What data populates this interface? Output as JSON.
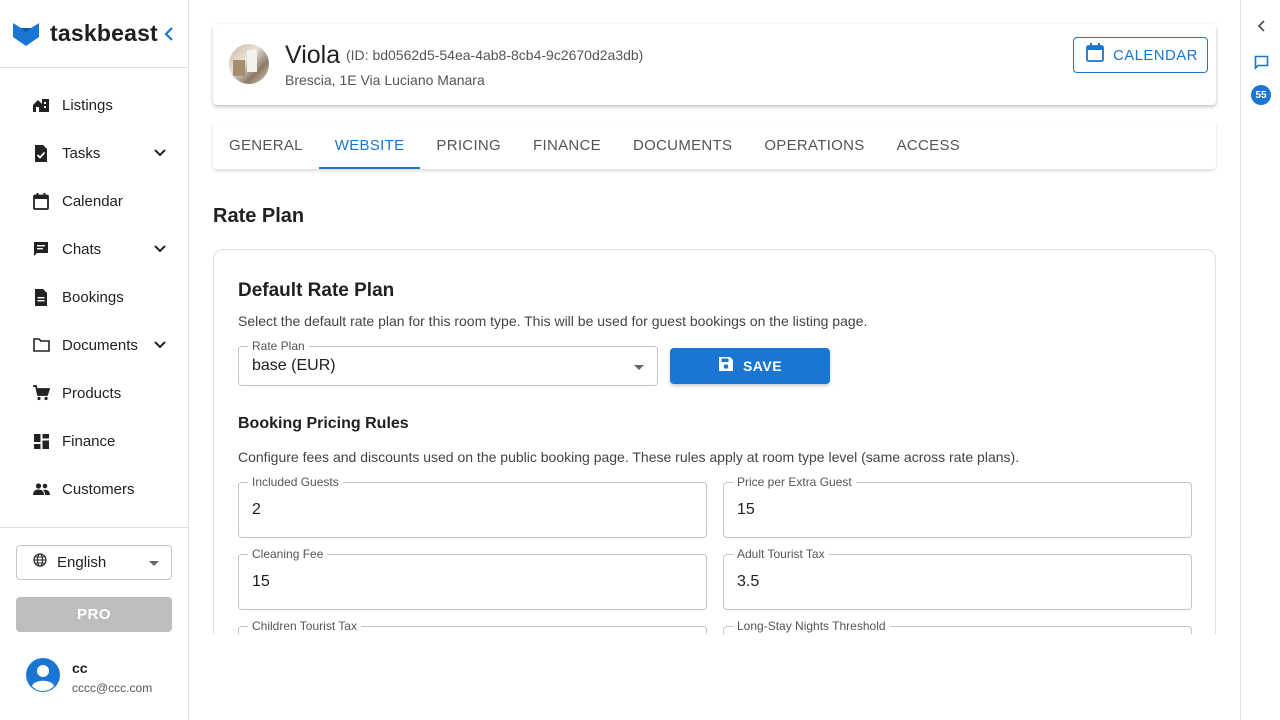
{
  "app": {
    "name": "taskbeast",
    "brand_color": "#1976d2"
  },
  "sidebar": {
    "items": [
      {
        "label": "Listings",
        "icon": "house-icon"
      },
      {
        "label": "Tasks",
        "icon": "task-icon"
      },
      {
        "label": "Calendar",
        "icon": "calendar-icon"
      },
      {
        "label": "Chats",
        "icon": "chat-icon"
      },
      {
        "label": "Bookings",
        "icon": "document-icon"
      },
      {
        "label": "Documents",
        "icon": "folder-icon"
      },
      {
        "label": "Products",
        "icon": "cart-icon"
      },
      {
        "label": "Finance",
        "icon": "dashboard-icon"
      },
      {
        "label": "Customers",
        "icon": "people-icon"
      }
    ],
    "language": "English",
    "pro_label": "PRO",
    "user": {
      "name": "cc",
      "email": "cccc@ccc.com"
    }
  },
  "rail": {
    "badge_count": "55"
  },
  "header": {
    "name": "Viola",
    "id_text": "(ID: bd0562d5-54ea-4ab8-8cb4-9c2670d2a3db)",
    "address": "Brescia, 1E Via Luciano Manara",
    "calendar_label": "CALENDAR"
  },
  "tabs": [
    {
      "label": "GENERAL",
      "active": false
    },
    {
      "label": "WEBSITE",
      "active": true
    },
    {
      "label": "PRICING",
      "active": false
    },
    {
      "label": "FINANCE",
      "active": false
    },
    {
      "label": "DOCUMENTS",
      "active": false
    },
    {
      "label": "OPERATIONS",
      "active": false
    },
    {
      "label": "ACCESS",
      "active": false
    }
  ],
  "main": {
    "section_title": "Rate Plan",
    "default_rate_plan": {
      "title": "Default Rate Plan",
      "description": "Select the default rate plan for this room type. This will be used for guest bookings on the listing page.",
      "select_label": "Rate Plan",
      "select_value": "base (EUR)",
      "save_label": "SAVE"
    },
    "booking_rules": {
      "title": "Booking Pricing Rules",
      "description": "Configure fees and discounts used on the public booking page. These rules apply at room type level (same across rate plans).",
      "fields": {
        "included_guests": {
          "label": "Included Guests",
          "value": "2"
        },
        "price_per_extra_guest": {
          "label": "Price per Extra Guest",
          "value": "15"
        },
        "cleaning_fee": {
          "label": "Cleaning Fee",
          "value": "15"
        },
        "adult_tourist_tax": {
          "label": "Adult Tourist Tax",
          "value": "3.5"
        },
        "children_tourist_tax": {
          "label": "Children Tourist Tax",
          "value": ""
        },
        "long_stay_threshold": {
          "label": "Long-Stay Nights Threshold",
          "value": ""
        }
      }
    }
  }
}
